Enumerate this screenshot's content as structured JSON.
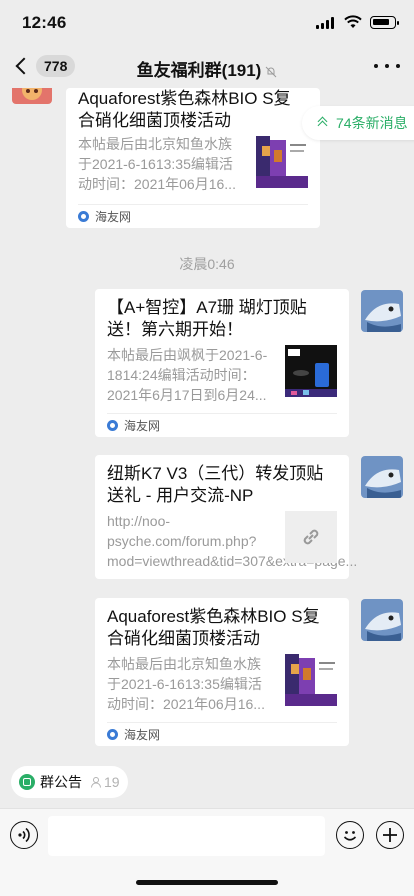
{
  "status": {
    "time": "12:46"
  },
  "nav": {
    "unread_count": "778",
    "title": "鱼友福利群(191)"
  },
  "new_messages": {
    "label": "74条新消息"
  },
  "timestamp": "凌晨0:46",
  "messages": [
    {
      "title": "Aquaforest紫色森林BIO S复合硝化细菌顶楼活动",
      "desc": "本帖最后由北京知鱼水族于2021-6-1613:35编辑活动时间：2021年06月16...",
      "source": "海友网"
    },
    {
      "title": "【A+智控】A7珊 瑚灯顶贴送！第六期开始！",
      "desc": "本帖最后由飒枫于2021-6-1814:24编辑活动时间：2021年6月17日到6月24...",
      "source": "海友网"
    },
    {
      "title": "纽斯K7 V3（三代）转发顶贴送礼 - 用户交流-NP",
      "desc": "http://noo-psyche.com/forum.php?mod=viewthread&tid=307&extra=page..."
    },
    {
      "title": "Aquaforest紫色森林BIO S复合硝化细菌顶楼活动",
      "desc": "本帖最后由北京知鱼水族于2021-6-1613:35编辑活动时间：2021年06月16...",
      "source": "海友网"
    }
  ],
  "announcement": {
    "label": "群公告",
    "count": "19"
  },
  "colors": {
    "accent": "#2aae67",
    "bg": "#ededed"
  }
}
